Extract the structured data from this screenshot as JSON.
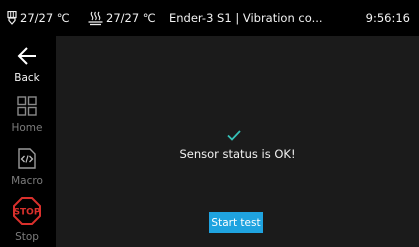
{
  "status_bar": {
    "nozzle_temp": "27/27 ℃",
    "bed_temp": "27/27 ℃",
    "title": "Ender-3 S1 | Vibration co...",
    "time": "9:56:16"
  },
  "sidebar": {
    "items": [
      {
        "label": "Back",
        "icon": "back-arrow-icon"
      },
      {
        "label": "Home",
        "icon": "grid-icon"
      },
      {
        "label": "Macro",
        "icon": "code-file-icon"
      },
      {
        "label": "Stop",
        "icon": "stop-sign-icon"
      }
    ]
  },
  "main": {
    "status_icon": "checkmark-icon",
    "status_message": "Sensor status is OK!",
    "start_button_label": "Start test"
  },
  "colors": {
    "accent": "#1fa3e0",
    "check": "#35c2b8",
    "stop": "#d9302c",
    "panel": "#1b1b1b"
  }
}
